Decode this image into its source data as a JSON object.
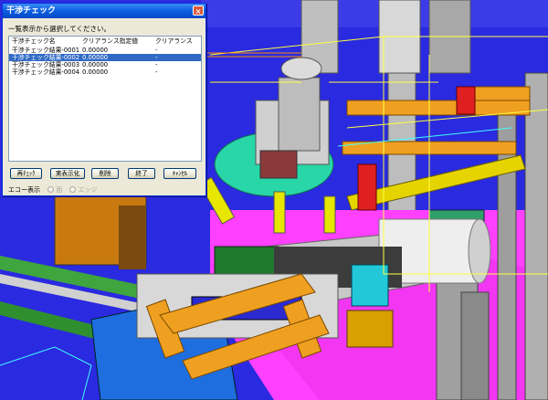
{
  "dialog": {
    "title": "干渉チェック",
    "close_symbol": "×",
    "prompt": "一覧表示から選択してください。",
    "columns": [
      "干渉チェック名",
      "クリアランス指定値",
      "クリアランス"
    ],
    "rows": [
      [
        "干渉チェック結果-0001",
        "0.00000",
        "-"
      ],
      [
        "干渉チェック結果-0002",
        "0.00000",
        "-"
      ],
      [
        "干渉チェック結果-0003",
        "0.00000",
        "-"
      ],
      [
        "干渉チェック結果-0004",
        "0.00000",
        "-"
      ]
    ],
    "selected_row": 1,
    "buttons": {
      "recheck": "再ﾁｪｯｸ",
      "visualize": "実表示化",
      "delete": "削除",
      "finish": "終了",
      "cancel": "ｷｬﾝｾﾙ"
    },
    "echo": {
      "label": "エコー表示",
      "option_face": "面",
      "option_edge": "エッジ"
    }
  },
  "colors": {
    "titlebar": "#0a5fe0",
    "selection": "#316ac5",
    "scene_background": "#2a2ae0"
  }
}
